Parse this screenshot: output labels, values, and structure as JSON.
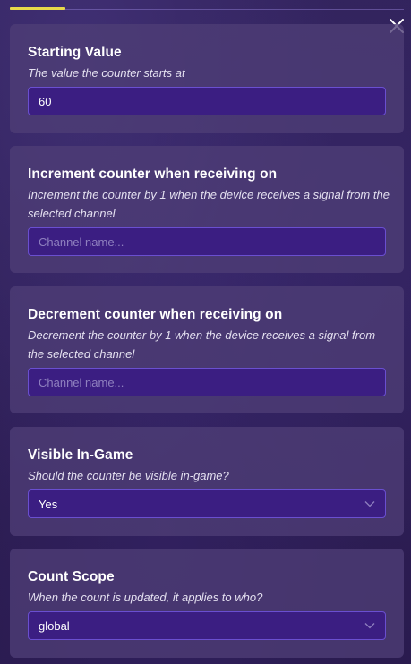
{
  "close_icon": "close-icon",
  "fields": {
    "starting_value": {
      "label": "Starting Value",
      "description": "The value the counter starts at",
      "value": "60"
    },
    "increment": {
      "label": "Increment counter when receiving on",
      "description": "Increment the counter by 1 when the device receives a signal from the selected channel",
      "placeholder": "Channel name..."
    },
    "decrement": {
      "label": "Decrement counter when receiving on",
      "description": "Decrement the counter by 1 when the device receives a signal from the selected channel",
      "placeholder": "Channel name..."
    },
    "visible": {
      "label": "Visible In-Game",
      "description": "Should the counter be visible in-game?",
      "value": "Yes"
    },
    "scope": {
      "label": "Count Scope",
      "description": "When the count is updated, it applies to who?",
      "value": "global"
    }
  },
  "colors": {
    "accent_tab": "#e8d94a",
    "input_bg": "#3b1e82",
    "input_border": "#6a4fd0",
    "panel_bg": "#4e3e76"
  }
}
